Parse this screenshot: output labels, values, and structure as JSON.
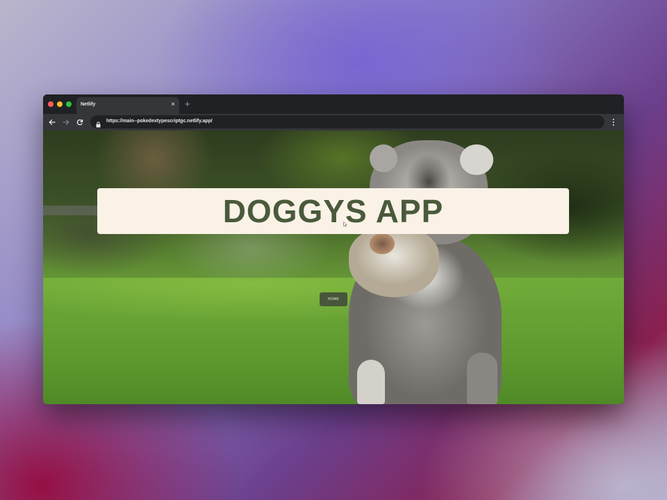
{
  "browser": {
    "tab_title": "Netlify",
    "close_tab_symbol": "×",
    "new_tab_symbol": "+",
    "url": "https://main--pokedextypescriptgc.netlify.app/",
    "icons": {
      "back": "arrow-left-icon",
      "forward": "arrow-right-icon",
      "reload": "reload-icon",
      "lock": "lock-icon",
      "menu": "more-vertical-icon"
    }
  },
  "page": {
    "title": "DOGGYS APP",
    "home_button_label": "HOME",
    "colors": {
      "banner_background": "#faf2e7",
      "title_text": "#4a5a3b",
      "button_background": "#48563b"
    }
  }
}
